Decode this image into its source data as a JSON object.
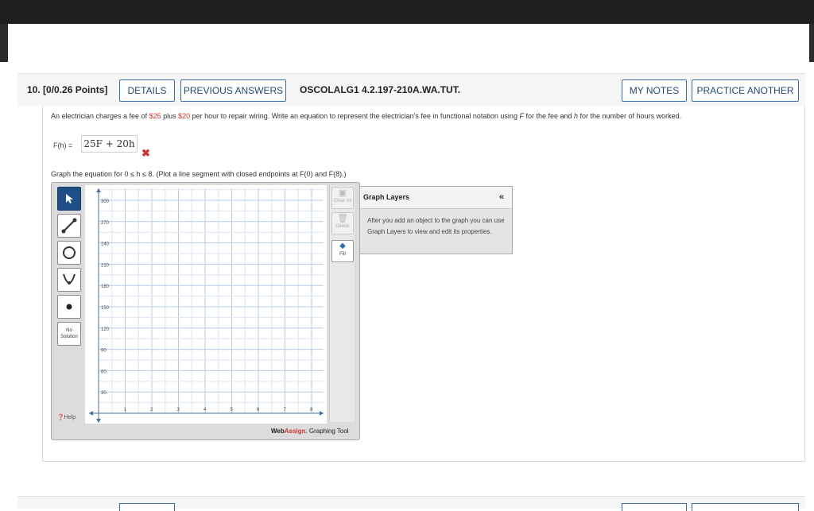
{
  "question": {
    "number": "10.",
    "points": "[0/0.26 Points]",
    "details_label": "DETAILS",
    "previous_answers_label": "PREVIOUS ANSWERS",
    "code": "OSCOLALG1 4.2.197-210A.WA.TUT.",
    "my_notes_label": "MY NOTES",
    "practice_another_label": "PRACTICE ANOTHER"
  },
  "problem": {
    "t1": "An electrician charges a fee of ",
    "fee": "$25",
    "t2": " plus ",
    "rate": "$20",
    "t3": " per hour to repair wiring. Write an equation to represent the electrician's fee in functional notation using ",
    "var_f": "F",
    "t4": " for the fee and ",
    "var_h": "h",
    "t5": " for the number of hours worked."
  },
  "answer": {
    "label": "F(h) =",
    "value": "25F + 20h",
    "status_icon": "wrong-x-icon"
  },
  "graph_instruction": "Graph the equation for  0 ≤ h ≤ 8.  (Plot a line segment with closed endpoints at  F(0)  and  F(8).)",
  "graph_tool": {
    "tools": [
      "pointer-icon",
      "line-segment-icon",
      "circle-icon",
      "parabola-icon",
      "point-icon"
    ],
    "no_solution_line1": "No",
    "no_solution_line2": "Solution",
    "help_label": "Help",
    "y_ticks": [
      "300",
      "270",
      "240",
      "210",
      "180",
      "150",
      "120",
      "90",
      "60",
      "30"
    ],
    "x_ticks": [
      "1",
      "2",
      "3",
      "4",
      "5",
      "6",
      "7",
      "8"
    ],
    "right_tools": {
      "clear_all": "Clear All",
      "delete": "Delete",
      "fill": "Fill"
    },
    "brand_web": "Web",
    "brand_assign": "Assign.",
    "brand_tail": " Graphing Tool"
  },
  "graph_layers": {
    "title": "Graph Layers",
    "collapse": "«",
    "text": "After you add an object to the graph you can use Graph Layers to view and edit its properties."
  },
  "colors": {
    "accent": "#3a6da8",
    "wrong": "#d0322d",
    "tool_active": "#1d4f86",
    "grid": "#b9cbe4"
  }
}
